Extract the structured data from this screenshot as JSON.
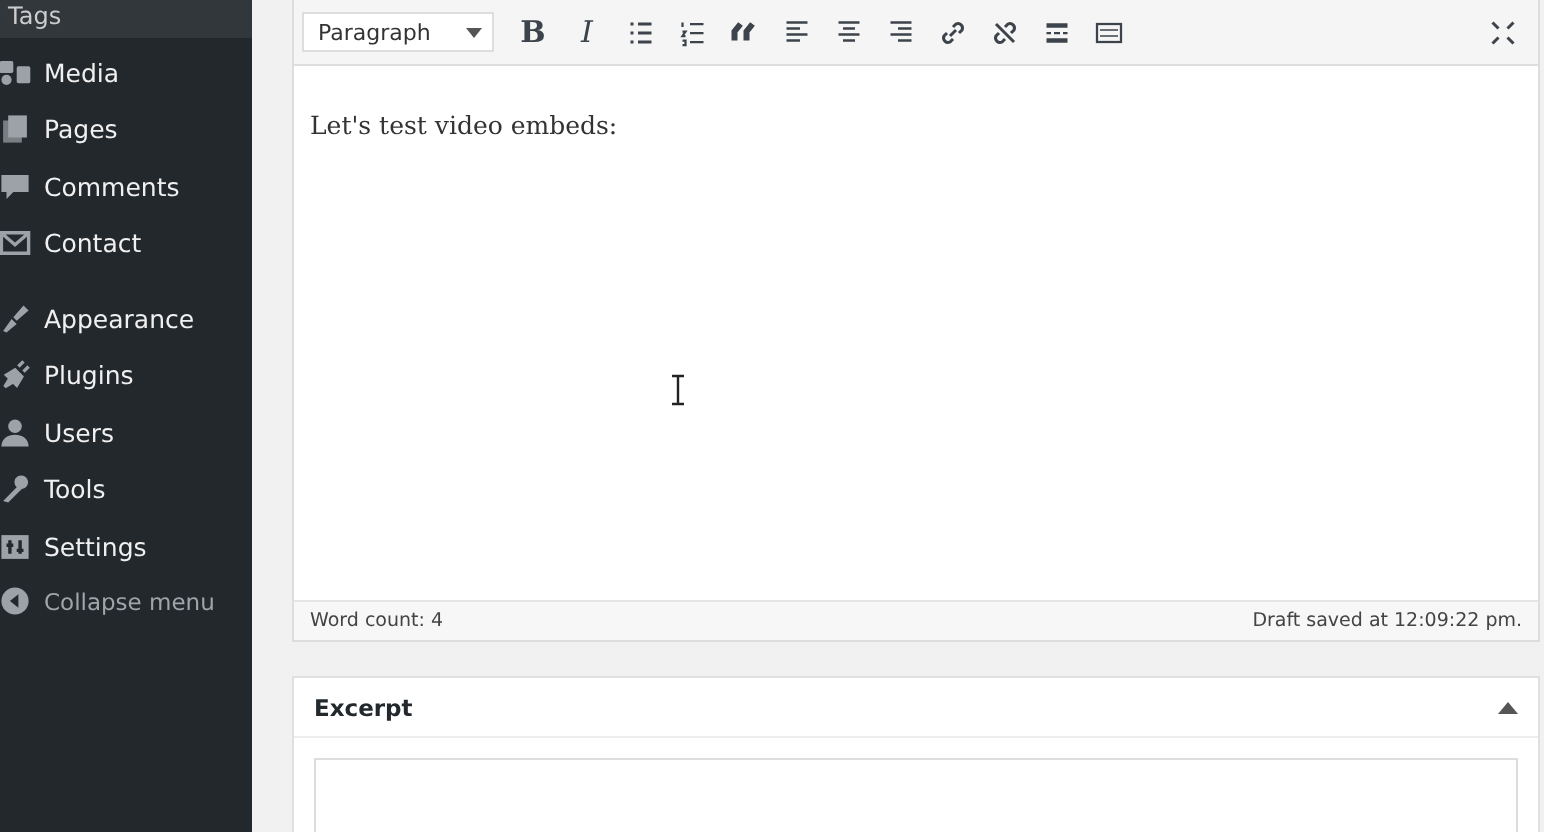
{
  "sidebar": {
    "submenu_item": "Tags",
    "groups": [
      [
        {
          "kind": "media",
          "label": "Media"
        },
        {
          "kind": "pages",
          "label": "Pages"
        },
        {
          "kind": "comments",
          "label": "Comments"
        },
        {
          "kind": "contact",
          "label": "Contact"
        }
      ],
      [
        {
          "kind": "appearance",
          "label": "Appearance"
        },
        {
          "kind": "plugins",
          "label": "Plugins"
        },
        {
          "kind": "users",
          "label": "Users"
        },
        {
          "kind": "tools",
          "label": "Tools"
        },
        {
          "kind": "settings",
          "label": "Settings"
        }
      ]
    ],
    "collapse": "Collapse menu"
  },
  "toolbar": {
    "format": "Paragraph",
    "buttons": [
      {
        "kind": "text",
        "label": "B"
      },
      {
        "kind": "text",
        "label": "I"
      },
      {
        "kind": "bullets"
      },
      {
        "kind": "numbers"
      },
      {
        "kind": "quote"
      },
      {
        "kind": "align-left"
      },
      {
        "kind": "align-center"
      },
      {
        "kind": "align-right"
      },
      {
        "kind": "link"
      },
      {
        "kind": "unlink"
      },
      {
        "kind": "more"
      },
      {
        "kind": "kitchen-sink"
      }
    ]
  },
  "editor": {
    "content": "Let's test video embeds:"
  },
  "status_bar": {
    "word_count": "Word count: 4",
    "draft": "Draft saved at 12:09:22 pm."
  },
  "excerpt": {
    "title": "Excerpt",
    "expanded": true
  }
}
